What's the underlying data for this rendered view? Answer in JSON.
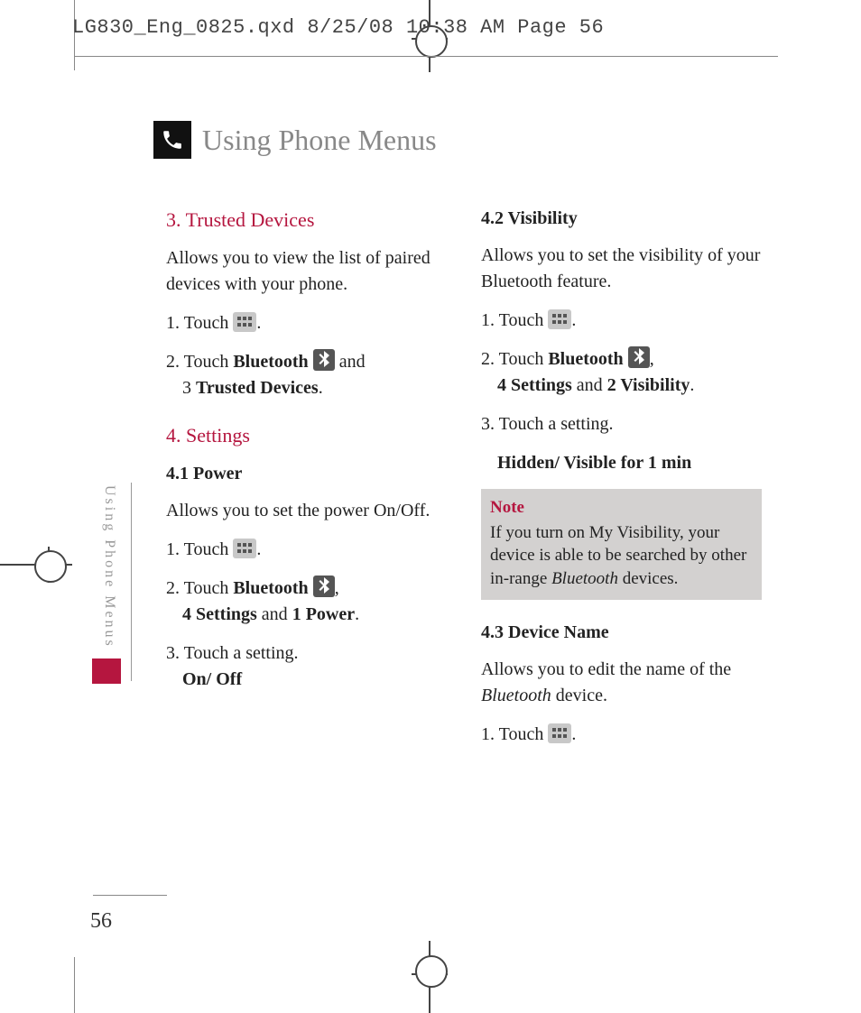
{
  "header_line": "LG830_Eng_0825.qxd  8/25/08  10:38 AM  Page 56",
  "title": "Using Phone Menus",
  "side_label": "Using Phone Menus",
  "page_number": "56",
  "left": {
    "h1": "3. Trusted Devices",
    "p1": "Allows you to view the list of paired devices with your phone.",
    "s1a": "1. Touch ",
    "s1b": ".",
    "s2a": "2. Touch ",
    "s2_bold1": "Bluetooth ",
    "s2b": " and",
    "s2c": "3 ",
    "s2_bold2": "Trusted Devices",
    "s2d": ".",
    "h2": "4. Settings",
    "h3": "4.1 Power",
    "p2": "Allows you to set the power On/Off.",
    "s3a": "1. Touch ",
    "s3b": ".",
    "s4a": "2. Touch ",
    "s4_bold1": "Bluetooth ",
    "s4b": ",",
    "s4_bold2": "4 Settings",
    "s4c": " and ",
    "s4_bold3": "1 Power",
    "s4d": ".",
    "s5a": "3. Touch a setting.",
    "s5_bold": "On/ Off"
  },
  "right": {
    "h1": "4.2 Visibility",
    "p1": "Allows you to set the visibility of your Bluetooth feature.",
    "s1a": "1. Touch ",
    "s1b": ".",
    "s2a": "2. Touch ",
    "s2_bold1": "Bluetooth ",
    "s2b": ",",
    "s2_bold2": "4 Settings",
    "s2c": " and ",
    "s2_bold3": "2 Visibility",
    "s2d": ".",
    "s3a": "3. Touch a setting.",
    "s3_bold": "Hidden/ Visible for 1 min",
    "note_title": "Note",
    "note_a": "If you turn on My Visibility, your device is able to be searched by other in-range ",
    "note_i": "Bluetooth",
    "note_b": " devices.",
    "h2": "4.3 Device Name",
    "p2a": "Allows you to edit the name of the ",
    "p2i": "Bluetooth",
    "p2b": " device.",
    "s4a": "1. Touch ",
    "s4b": "."
  }
}
